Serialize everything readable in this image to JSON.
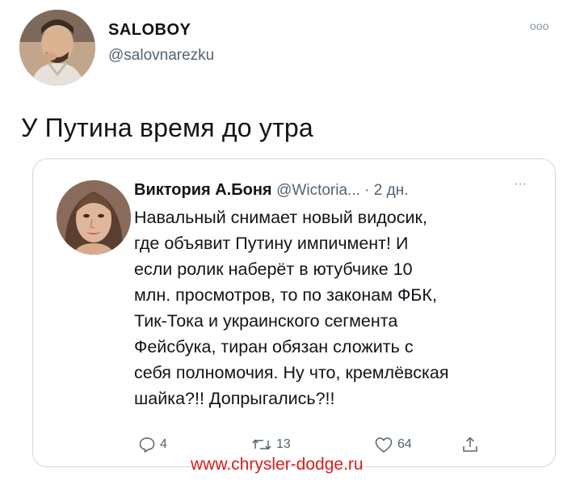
{
  "tweet": {
    "display_name": "SALOBOY",
    "handle": "@salovnarezku",
    "more_label": "ooo",
    "text": "У Путина время до утра"
  },
  "quoted": {
    "name": "Виктория А.Боня",
    "meta": "@Wictoria... · 2 дн.",
    "more_label": "···",
    "lines": [
      "Навальный снимает новый видосик,",
      "где объявит Путину импичмент! И",
      "если ролик наберёт в ютубчике 10",
      "млн. просмотров, то по законам ФБК,",
      "Тик-Тока и украинского сегмента",
      "Фейсбука, тиран обязан сложить с",
      "себя полномочия. Ну что, кремлёвская",
      "шайка?!! Допрыгались?!!"
    ],
    "actions": {
      "reply_count": "4",
      "retweet_count": "13",
      "like_count": "64"
    }
  },
  "watermark": "www.chrysler-dodge.ru",
  "icons": [
    "avatar-photo",
    "reply-icon",
    "retweet-icon",
    "like-icon",
    "share-icon"
  ],
  "colors": {
    "secondary_text": "#536471",
    "border": "#cfd9de",
    "watermark": "#d81e1e"
  }
}
